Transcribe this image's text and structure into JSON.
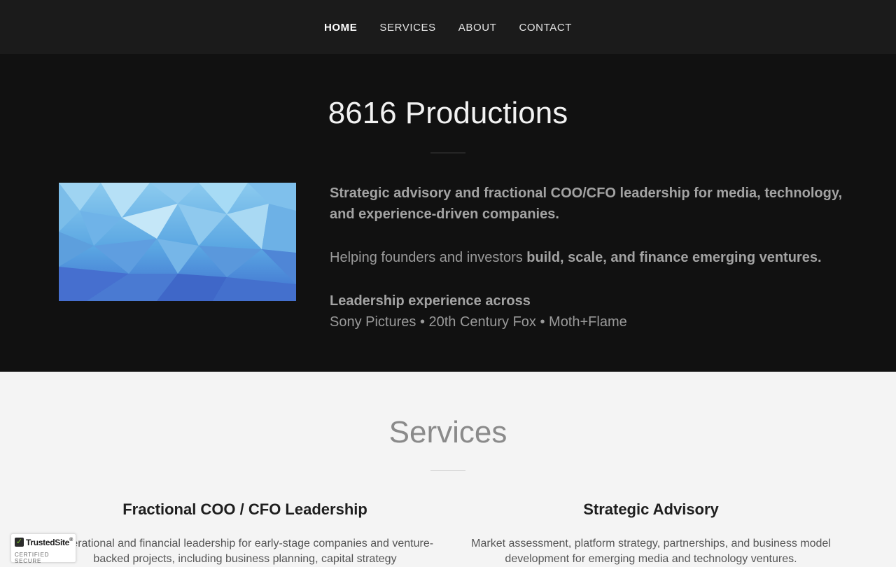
{
  "nav": {
    "items": [
      {
        "label": "HOME",
        "active": true
      },
      {
        "label": "SERVICES"
      },
      {
        "label": "ABOUT"
      },
      {
        "label": "CONTACT"
      }
    ]
  },
  "hero": {
    "title": "8616 Productions",
    "tagline": "Strategic advisory and fractional COO/CFO leadership for media, technology, and experience-driven companies.",
    "helping_prefix": "Helping founders and investors ",
    "helping_bold": "build, scale, and finance emerging ventures.",
    "experience_heading": "Leadership experience across",
    "experience_list": "Sony Pictures • 20th Century Fox • Moth+Flame"
  },
  "services": {
    "title": "Services",
    "items": [
      {
        "title": "Fractional COO / CFO Leadership",
        "description": "Operational and financial leadership for early-stage companies and venture-backed projects, including business planning, capital strategy"
      },
      {
        "title": "Strategic Advisory",
        "description": "Market assessment, platform strategy, partnerships, and business model development for emerging media and technology ventures."
      }
    ]
  },
  "badge": {
    "name": "TrustedSite",
    "reg": "®",
    "subtitle": "CERTIFIED SECURE"
  },
  "colors": {
    "nav_bg": "#1b1b1b",
    "hero_bg": "#111111",
    "section_bg": "#f4f4f4",
    "badge_check": "#79c12a"
  },
  "icons": {
    "badge": "checkmark-icon"
  }
}
